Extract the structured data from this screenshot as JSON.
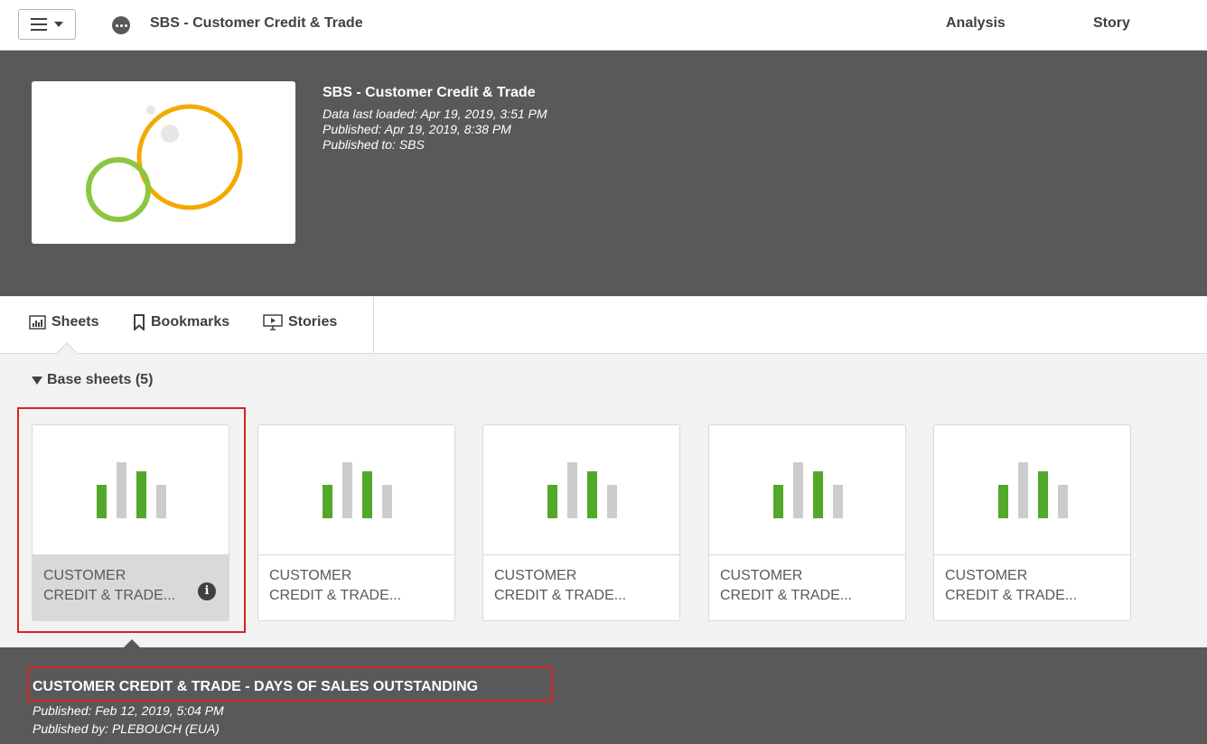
{
  "topbar": {
    "app_title": "SBS - Customer Credit & Trade",
    "nav": {
      "analysis": "Analysis",
      "story": "Story"
    }
  },
  "app": {
    "name": "SBS - Customer Credit & Trade",
    "meta": [
      "Data last loaded: Apr 19, 2019, 3:51 PM",
      "Published: Apr 19, 2019, 8:38 PM",
      "Published to: SBS"
    ]
  },
  "tabs": {
    "sheets": "Sheets",
    "bookmarks": "Bookmarks",
    "stories": "Stories"
  },
  "section": {
    "title": "Base sheets (5)"
  },
  "sheets": [
    {
      "line1": "CUSTOMER",
      "line2": "CREDIT & TRADE..."
    },
    {
      "line1": "CUSTOMER",
      "line2": "CREDIT & TRADE..."
    },
    {
      "line1": "CUSTOMER",
      "line2": "CREDIT & TRADE..."
    },
    {
      "line1": "CUSTOMER",
      "line2": "CREDIT & TRADE..."
    },
    {
      "line1": "CUSTOMER",
      "line2": "CREDIT & TRADE..."
    }
  ],
  "detail": {
    "title": "CUSTOMER CREDIT & TRADE - DAYS OF SALES OUTSTANDING",
    "published": "Published: Feb 12, 2019, 5:04 PM",
    "published_by": "Published by: PLEBOUCH (EUA)"
  },
  "colors": {
    "header_bg": "#595959",
    "accent_green": "#52a829",
    "bar_gray": "#cccccc",
    "highlight_red": "#e02020",
    "logo_orange": "#f5a800",
    "logo_green": "#8cc63f"
  },
  "icons": {
    "menu": "hamburger-menu-icon",
    "app": "more-dots-icon",
    "sheets": "sheets-chart-icon",
    "bookmarks": "bookmark-icon",
    "stories": "stories-presentation-icon",
    "info": "info-icon"
  }
}
